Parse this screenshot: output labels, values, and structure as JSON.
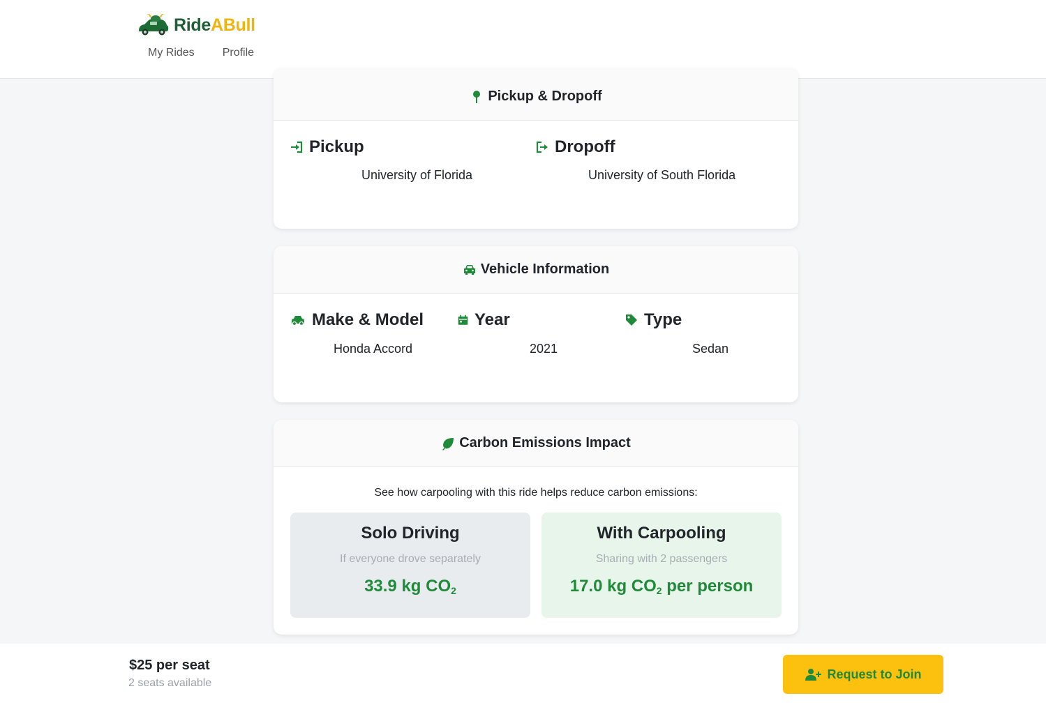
{
  "brand": {
    "part1": "Ride",
    "part2": "ABull",
    "logo": "bull-car-logo"
  },
  "nav": {
    "my_rides": "My Rides",
    "profile": "Profile"
  },
  "pickup_dropoff": {
    "title": "Pickup & Dropoff",
    "icon": "map-pin-icon",
    "pickup_label": "Pickup",
    "pickup_value": "University of Florida",
    "dropoff_label": "Dropoff",
    "dropoff_value": "University of South Florida"
  },
  "vehicle": {
    "title": "Vehicle Information",
    "make_label": "Make & Model",
    "make_value": "Honda Accord",
    "year_label": "Year",
    "year_value": "2021",
    "type_label": "Type",
    "type_value": "Sedan"
  },
  "carbon": {
    "title": "Carbon Emissions Impact",
    "intro": "See how carpooling with this ride helps reduce carbon emissions:",
    "solo": {
      "title": "Solo Driving",
      "subtitle": "If everyone drove separately",
      "value": "33.9 kg CO",
      "sub": "2",
      "suffix": ""
    },
    "carpool": {
      "title": "With Carpooling",
      "subtitle": "Sharing with 2 passengers",
      "value": "17.0 kg CO",
      "sub": "2",
      "suffix": " per person"
    }
  },
  "footer": {
    "price": "$25 per seat",
    "seats": "2 seats available",
    "join_label": "Request to Join"
  },
  "colors": {
    "brand_green": "#1f5f34",
    "accent_green": "#1f8b3a",
    "brand_yellow": "#fcc10f"
  }
}
